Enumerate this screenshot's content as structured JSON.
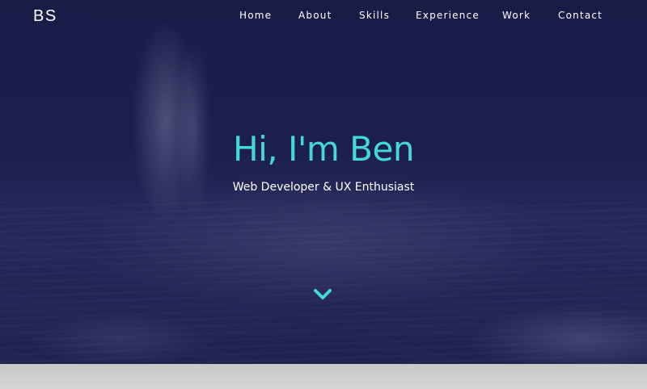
{
  "header": {
    "logo": "BS",
    "nav": [
      {
        "label": "Home"
      },
      {
        "label": "About"
      },
      {
        "label": "Skills"
      },
      {
        "label": "Experience"
      },
      {
        "label": "Work"
      },
      {
        "label": "Contact"
      }
    ]
  },
  "hero": {
    "headline": "Hi, I'm Ben",
    "subtitle": "Web Developer & UX Enthusiast",
    "scroll_icon": "chevron-down-icon",
    "colors": {
      "accent": "#45d9d3",
      "overlay": "#1b1d4b",
      "text": "#ffffff"
    }
  }
}
